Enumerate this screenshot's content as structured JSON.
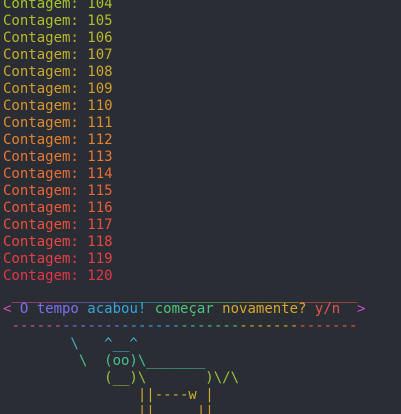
{
  "terminal": {
    "count_lines": [
      {
        "text": "Contagem: 104",
        "color": "#a8c32a"
      },
      {
        "text": "Contagem: 105",
        "color": "#b0bf2a"
      },
      {
        "text": "Contagem: 106",
        "color": "#b8b82a"
      },
      {
        "text": "Contagem: 107",
        "color": "#c2b02a"
      },
      {
        "text": "Contagem: 108",
        "color": "#caa82a"
      },
      {
        "text": "Contagem: 109",
        "color": "#d29e2a"
      },
      {
        "text": "Contagem: 110",
        "color": "#d8962c"
      },
      {
        "text": "Contagem: 111",
        "color": "#de8c2e"
      },
      {
        "text": "Contagem: 112",
        "color": "#e2822f"
      },
      {
        "text": "Contagem: 113",
        "color": "#e67832"
      },
      {
        "text": "Contagem: 114",
        "color": "#e86e34"
      },
      {
        "text": "Contagem: 115",
        "color": "#ea6437"
      },
      {
        "text": "Contagem: 116",
        "color": "#ea5a3a"
      },
      {
        "text": "Contagem: 117",
        "color": "#ea503d"
      },
      {
        "text": "Contagem: 118",
        "color": "#e84840"
      },
      {
        "text": "Contagem: 119",
        "color": "#e63f44"
      },
      {
        "text": "Contagem: 120",
        "color": "#e23648"
      }
    ],
    "bubble_top": " _________________________________________",
    "bubble_segments": [
      {
        "text": "< ",
        "color": "#d14fb0"
      },
      {
        "text": "O tempo ",
        "color": "#7b6ff0"
      },
      {
        "text": "acabou! ",
        "color": "#33a7d8"
      },
      {
        "text": "começar ",
        "color": "#4cc47a"
      },
      {
        "text": "novamente? ",
        "color": "#d6a72c"
      },
      {
        "text": "y/n  ",
        "color": "#e2584b"
      },
      {
        "text": ">",
        "color": "#c84ad0"
      }
    ],
    "bubble_bottom": " -----------------------------------------",
    "bubble_colors": [
      "#d14fb0",
      "#7b6ff0",
      "#33a7d8",
      "#4cc47a",
      "#d6a72c",
      "#e2584b"
    ],
    "cow": [
      {
        "text": "        \\   ^__^",
        "color": "#3fb3c8"
      },
      {
        "text": "         \\  (oo)\\_______",
        "color": "#47c08a"
      },
      {
        "text": "            (__)\\       )\\/\\",
        "color": "#9cc23a"
      },
      {
        "text": "                ||----w |",
        "color": "#c8b02a"
      },
      {
        "text": "                ||     ||",
        "color": "#d89a2c"
      }
    ]
  }
}
